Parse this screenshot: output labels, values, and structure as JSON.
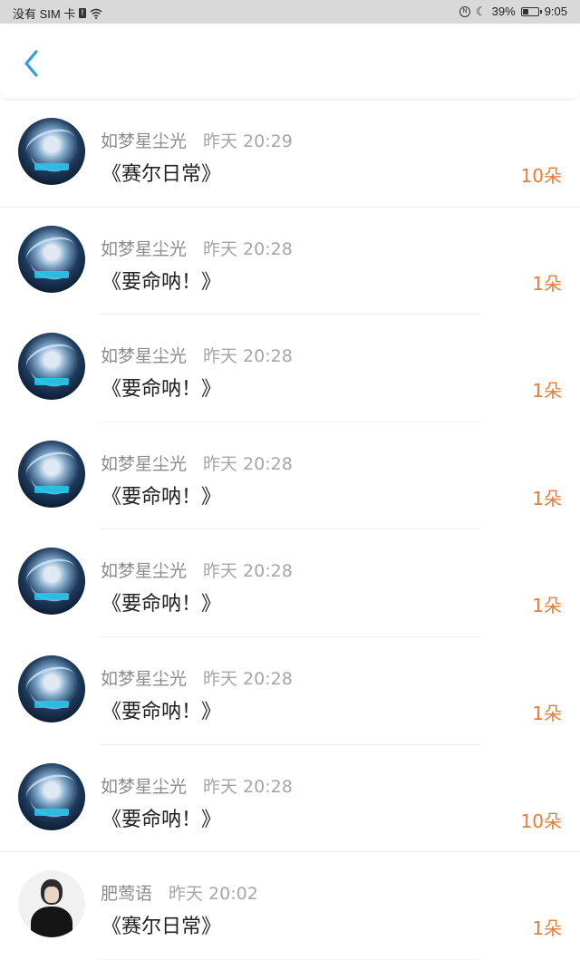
{
  "status_bar": {
    "carrier": "没有 SIM 卡",
    "battery": "39%",
    "time": "9:05",
    "battery_level": 0.39
  },
  "colors": {
    "accent": "#2e9ee6",
    "count": "#ea7d36"
  },
  "items": [
    {
      "name": "如梦星尘光",
      "time": "昨天 20:29",
      "title": "《赛尔日常》",
      "count": "10朵",
      "avatar": "anime-avatar"
    },
    {
      "name": "如梦星尘光",
      "time": "昨天 20:28",
      "title": "《要命呐！》",
      "count": "1朵",
      "avatar": "anime-avatar"
    },
    {
      "name": "如梦星尘光",
      "time": "昨天 20:28",
      "title": "《要命呐！》",
      "count": "1朵",
      "avatar": "anime-avatar"
    },
    {
      "name": "如梦星尘光",
      "time": "昨天 20:28",
      "title": "《要命呐！》",
      "count": "1朵",
      "avatar": "anime-avatar"
    },
    {
      "name": "如梦星尘光",
      "time": "昨天 20:28",
      "title": "《要命呐！》",
      "count": "1朵",
      "avatar": "anime-avatar"
    },
    {
      "name": "如梦星尘光",
      "time": "昨天 20:28",
      "title": "《要命呐！》",
      "count": "1朵",
      "avatar": "anime-avatar"
    },
    {
      "name": "如梦星尘光",
      "time": "昨天 20:28",
      "title": "《要命呐！》",
      "count": "10朵",
      "avatar": "anime-avatar"
    },
    {
      "name": "肥莺语",
      "time": "昨天 20:02",
      "title": "《赛尔日常》",
      "count": "1朵",
      "avatar": "person-avatar"
    }
  ]
}
